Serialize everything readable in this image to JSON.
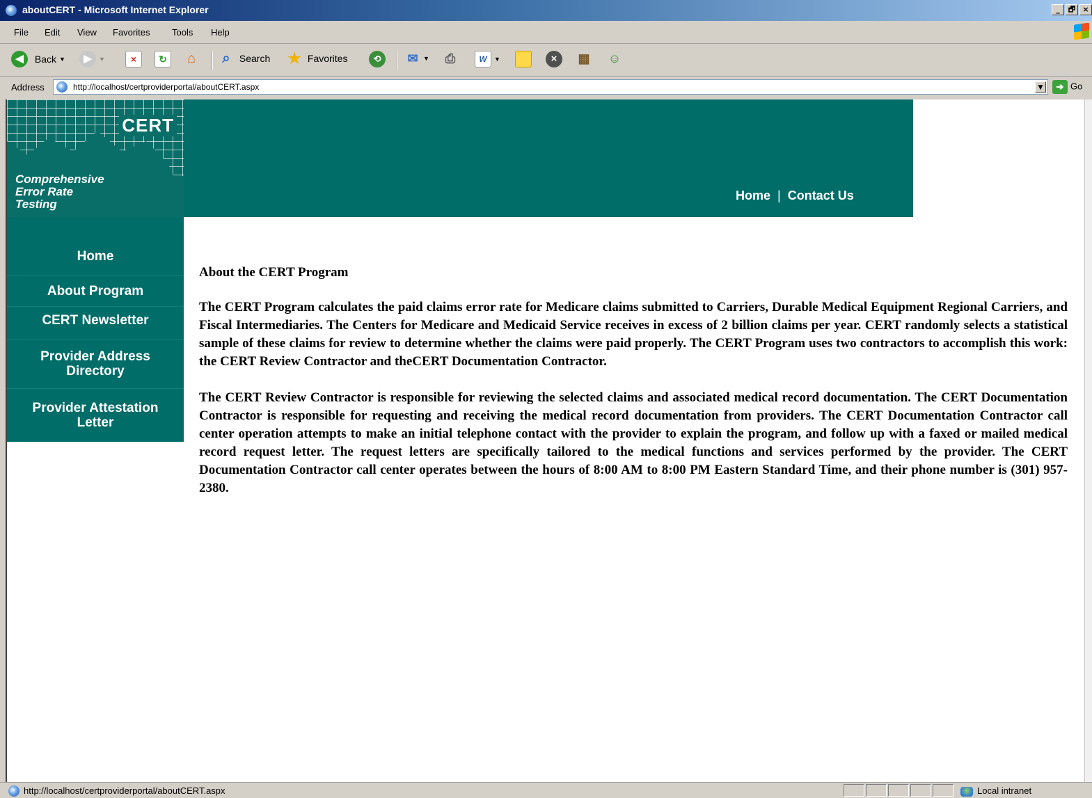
{
  "window": {
    "title": "aboutCERT - Microsoft Internet Explorer",
    "buttons": [
      "_",
      "🗗",
      "×"
    ]
  },
  "menu": [
    "File",
    "Edit",
    "View",
    "Favorites",
    "Tools",
    "Help"
  ],
  "toolbar": {
    "back_label": "Back",
    "search_label": "Search",
    "favorites_label": "Favorites"
  },
  "address": {
    "label": "Address",
    "url": "http://localhost/certproviderportal/aboutCERT.aspx",
    "go_label": "Go"
  },
  "logo": {
    "word": "CERT",
    "line1": "Comprehensive",
    "line2": "Error Rate",
    "line3": "Testing"
  },
  "topnav": {
    "home": "Home",
    "separator": "|",
    "contact": "Contact Us"
  },
  "sidebar": {
    "items": [
      {
        "label": "Home"
      },
      {
        "label": "About Program"
      },
      {
        "label": "CERT Newsletter"
      },
      {
        "label": "Provider Address Directory"
      },
      {
        "label": "Provider Attestation Letter"
      }
    ]
  },
  "content": {
    "heading": "About the CERT Program",
    "paragraphs": [
      "The CERT Program calculates the paid claims error rate for Medicare claims submitted to Carriers, Durable Medical Equipment Regional Carriers, and Fiscal Intermediaries. The Centers for Medicare and Medicaid Service receives in excess of 2 billion claims per year. CERT randomly selects a statistical sample of these claims for review to determine whether the claims were paid properly. The CERT Program uses two contractors to accomplish this work: the CERT Review Contractor and theCERT Documentation Contractor.",
      "The CERT Review Contractor is responsible for reviewing the selected claims and associated medical record documentation. The CERT Documentation Contractor is responsible for requesting and receiving the medical record documentation from providers. The CERT Documentation Contractor call center operation attempts to make an initial telephone contact with the provider to explain the program, and follow up with a faxed or mailed medical record request letter. The request letters are specifically tailored to the medical functions and services performed by the provider. The CERT Documentation Contractor call center operates between the hours of 8:00 AM to 8:00 PM Eastern Standard Time, and their phone number is (301) 957-2380."
    ]
  },
  "status": {
    "url": "http://localhost/certproviderportal/aboutCERT.aspx",
    "zone": "Local intranet"
  },
  "colors": {
    "brand_teal": "#006d68",
    "titlebar_blue": "#0a246a"
  },
  "icons": [
    "ie-logo-icon",
    "back-icon",
    "forward-icon",
    "stop-icon",
    "refresh-icon",
    "home-icon",
    "search-icon",
    "favorites-star-icon",
    "history-icon",
    "mail-icon",
    "print-icon",
    "edit-icon",
    "discuss-icon",
    "close-circle-icon",
    "research-icon",
    "messenger-icon",
    "go-arrow-icon",
    "local-intranet-icon"
  ]
}
